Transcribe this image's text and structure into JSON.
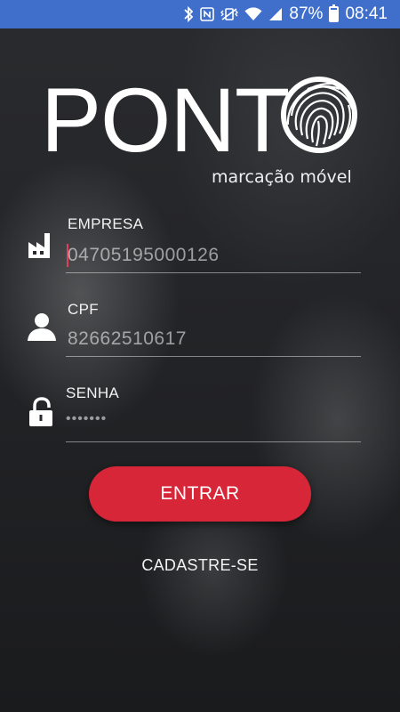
{
  "status_bar": {
    "battery_percent": "87%",
    "battery_level": 0.87,
    "time": "08:41",
    "icons": [
      "bluetooth-icon",
      "nfc-icon",
      "vibrate-icon",
      "wifi-icon",
      "signal-icon",
      "battery-icon"
    ],
    "background": "#3f6ecb"
  },
  "logo": {
    "brand": "PONT",
    "tagline": "marcação móvel"
  },
  "form": {
    "empresa": {
      "label": "EMPRESA",
      "value": "04705195000126",
      "icon": "factory-icon"
    },
    "cpf": {
      "label": "CPF",
      "value": "82662510617",
      "icon": "user-icon"
    },
    "senha": {
      "label": "SENHA",
      "value": "•••••••",
      "icon": "lock-icon"
    }
  },
  "actions": {
    "login_label": "ENTRAR",
    "signup_label": "CADASTRE-SE"
  },
  "colors": {
    "accent": "#d72638",
    "cursor": "#e0405a"
  }
}
